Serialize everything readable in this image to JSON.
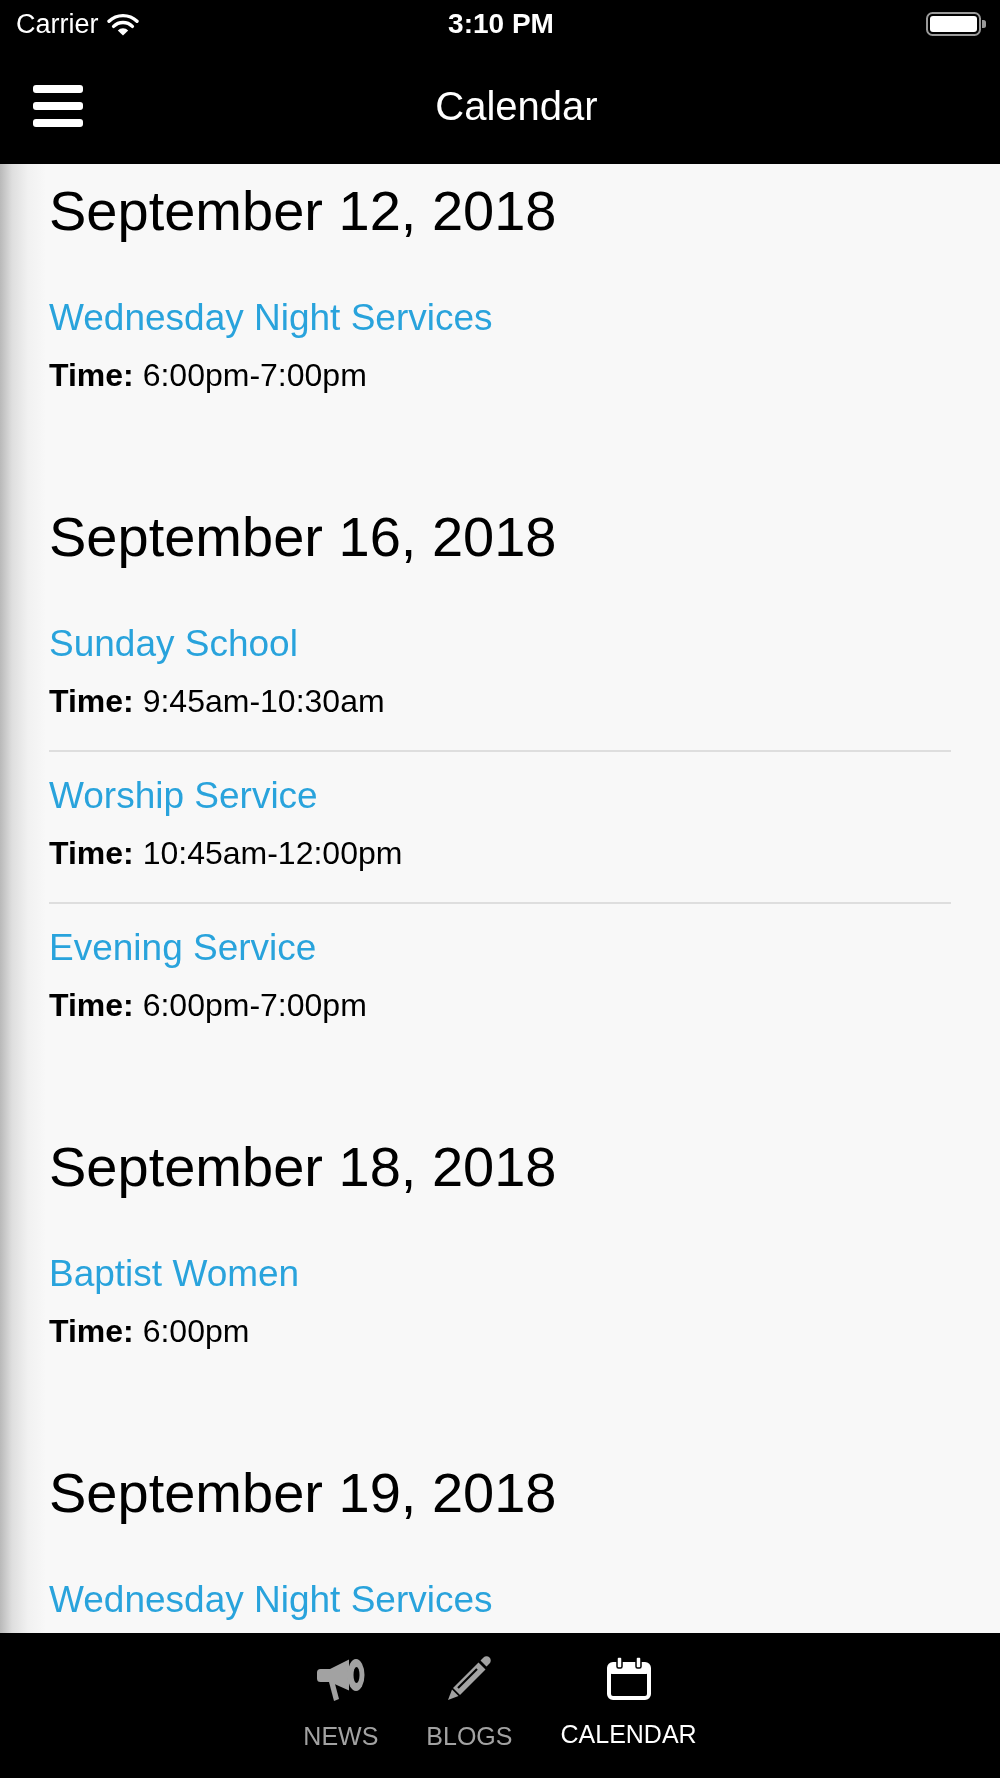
{
  "status_bar": {
    "carrier": "Carrier",
    "time": "3:10 PM"
  },
  "nav_bar": {
    "title": "Calendar"
  },
  "days": [
    {
      "date": "September 12, 2018",
      "events": [
        {
          "title": "Wednesday Night Services",
          "time": "**Time:** 6:00pm-7:00pm"
        }
      ]
    },
    {
      "date": "September 16, 2018",
      "events": [
        {
          "title": "Sunday School",
          "time": "**Time:** 9:45am-10:30am"
        },
        {
          "title": "Worship Service",
          "time": "**Time:** 10:45am-12:00pm"
        },
        {
          "title": "Evening Service",
          "time": "**Time:** 6:00pm-7:00pm"
        }
      ]
    },
    {
      "date": "September 18, 2018",
      "events": [
        {
          "title": "Baptist Women",
          "time": "**Time:** 6:00pm"
        }
      ]
    },
    {
      "date": "September 19, 2018",
      "events": [
        {
          "title": "Wednesday Night Services"
        }
      ]
    }
  ],
  "tab_bar": [
    {
      "label": "NEWS",
      "kind": "megaphone",
      "selected": false
    },
    {
      "label": "BLOGS",
      "kind": "pencil",
      "selected": false
    },
    {
      "label": "CALENDAR",
      "kind": "calendar",
      "selected": true
    }
  ]
}
